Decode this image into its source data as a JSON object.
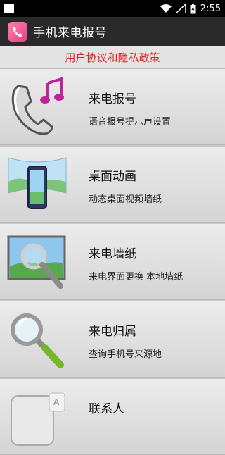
{
  "status_bar": {
    "time": "2:55",
    "icons": [
      "notification-icon",
      "wifi-icon",
      "signal-icon",
      "battery-icon"
    ]
  },
  "app_bar": {
    "title": "手机来电报号",
    "icon": "phone-app-icon"
  },
  "policy_link": "用户协议和隐私政策",
  "colors": {
    "appbar": "#292929",
    "policy_text": "#e21f1f",
    "row_bg": "#e2e2e2"
  },
  "menu": {
    "items": [
      {
        "title": "来电报号",
        "subtitle": "语音报号提示声设置",
        "icon": "phone-music-icon"
      },
      {
        "title": "桌面动画",
        "subtitle": "动态桌面视频墙纸",
        "icon": "phone-wallpaper-icon"
      },
      {
        "title": "来电墙纸",
        "subtitle": "来电界面更换 本地墙纸",
        "icon": "picture-magnifier-icon"
      },
      {
        "title": "来电归属",
        "subtitle": "查询手机号来源地",
        "icon": "magnifier-icon"
      },
      {
        "title": "联系人",
        "subtitle": "",
        "icon": "contacts-icon"
      }
    ]
  }
}
